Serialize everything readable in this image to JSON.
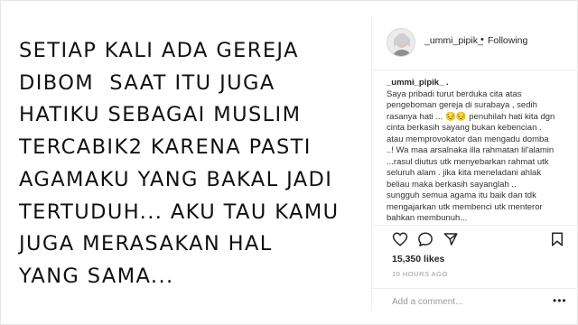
{
  "post_image": {
    "lines": [
      "SETIAP KALI ADA GEREJA",
      "DIBOM  SAAT ITU JUGA",
      "HATIKU SEBAGAI MUSLIM",
      "TERCABIK2 KARENA PASTI",
      "AGAMAKU YANG BAKAL JADI",
      "TERTUDUH... AKU TAU KAMU",
      "JUGA MERASAKAN HAL",
      "YANG SAMA..."
    ]
  },
  "header": {
    "username": "_ummi_pipik_",
    "separator": "•",
    "follow_label": "Following"
  },
  "caption": {
    "username": "_ummi_pipik_",
    "username_suffix": " .",
    "lines": [
      "Saya pribadi turut berduka cita atas",
      "pengeboman gereja di surabaya , sedih",
      "rasanya hati ... 😔😔 penuhilah hati kita dgn",
      "cinta berkasih sayang bukan kebencian .",
      "atau memprovokator dan mengadu domba",
      "..! Wa maa arsalnaka illa rahmatan lil'alamin",
      "...rasul diutus utk menyebarkan rahmat utk",
      "seluruh alam . jika kita meneladani ahlak",
      "beliau maka berkasih sayanglah ..",
      "sungguh semua agama itu baik dan tdk",
      "mengajarkan utk membenci utk menteror",
      "bahkan membunuh..."
    ]
  },
  "actions": {
    "icons": [
      "heart-icon",
      "comment-icon",
      "share-icon",
      "bookmark-icon"
    ]
  },
  "likes": "15,350 likes",
  "timestamp": "10 HOURS AGO",
  "comment_input": {
    "placeholder": "Add a comment..."
  },
  "more_label": "•••"
}
